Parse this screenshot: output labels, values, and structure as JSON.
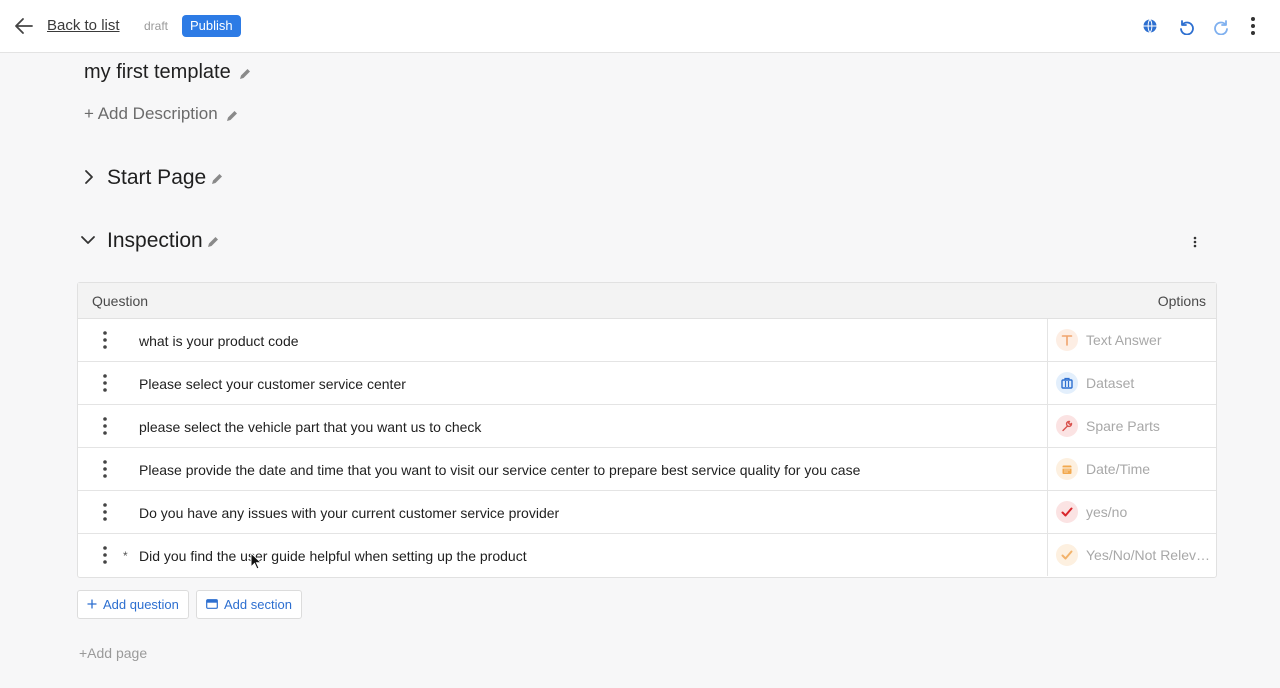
{
  "header": {
    "back_label": "Back to list",
    "status": "draft",
    "publish_label": "Publish"
  },
  "template": {
    "title": "my first template",
    "add_description": "+ Add Description"
  },
  "pages": [
    {
      "title": "Start Page",
      "expanded": false
    },
    {
      "title": "Inspection",
      "expanded": true
    }
  ],
  "table": {
    "col_question": "Question",
    "col_options": "Options",
    "rows": [
      {
        "text": "what is your product code",
        "required": false,
        "option": "Text Answer",
        "icon": "text-icon"
      },
      {
        "text": "Please select your customer service center",
        "required": false,
        "option": "Dataset",
        "icon": "dataset-icon"
      },
      {
        "text": "please select the vehicle part that you want us to check",
        "required": false,
        "option": "Spare Parts",
        "icon": "wrench-icon"
      },
      {
        "text": "Please provide the date and time that you want to visit our service center to prepare best service quality for you case",
        "required": false,
        "option": "Date/Time",
        "icon": "calendar-icon"
      },
      {
        "text": "Do you have any issues with your current customer service provider",
        "required": false,
        "option": "yes/no",
        "icon": "check-icon"
      },
      {
        "text": "Did you find the user guide helpful when setting up the product",
        "required": true,
        "required_mark": "*",
        "option": "Yes/No/Not Relevant",
        "icon": "check-icon"
      }
    ]
  },
  "actions": {
    "add_question": "Add question",
    "add_section": "Add section",
    "add_page": "+Add page"
  },
  "colors": {
    "accent": "#2d7be5",
    "link": "#2d6fd0"
  }
}
